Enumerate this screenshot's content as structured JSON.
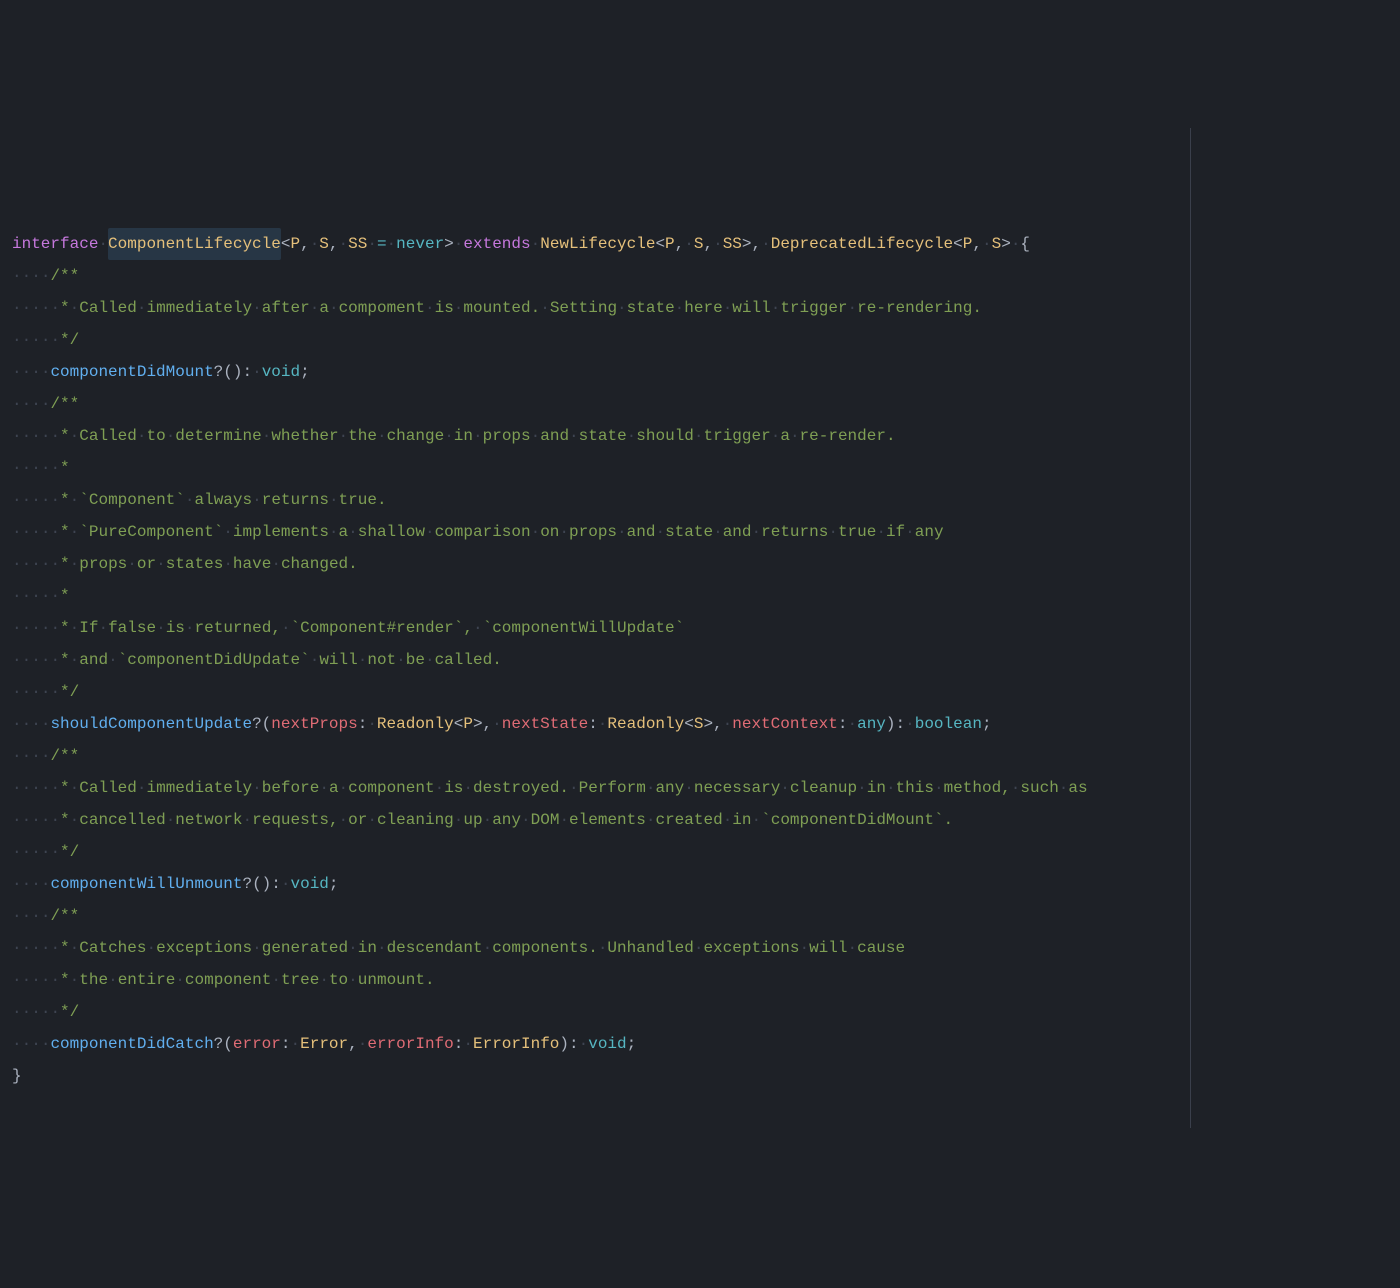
{
  "colors": {
    "background": "#1e2127",
    "keyword": "#c678dd",
    "type": "#e5c07b",
    "comment": "#7f9f54",
    "function": "#61afef",
    "param": "#e06c75",
    "primitive": "#56b6c2",
    "default": "#abb2bf",
    "whitespace_dot": "#3e4451"
  },
  "code": {
    "lines": [
      {
        "indent": 0,
        "segments": [
          {
            "class": "kw",
            "text": "interface"
          },
          {
            "class": "pale",
            "text": " "
          },
          {
            "class": "type highlight-word",
            "text": "ComponentLifecycle"
          },
          {
            "class": "punct",
            "text": "<"
          },
          {
            "class": "typename",
            "text": "P"
          },
          {
            "class": "punct",
            "text": ", "
          },
          {
            "class": "typename",
            "text": "S"
          },
          {
            "class": "punct",
            "text": ", "
          },
          {
            "class": "typename",
            "text": "SS"
          },
          {
            "class": "pale",
            "text": " "
          },
          {
            "class": "op",
            "text": "="
          },
          {
            "class": "pale",
            "text": " "
          },
          {
            "class": "primitive",
            "text": "never"
          },
          {
            "class": "punct",
            "text": "> "
          },
          {
            "class": "kw",
            "text": "extends"
          },
          {
            "class": "pale",
            "text": " "
          },
          {
            "class": "typename",
            "text": "NewLifecycle"
          },
          {
            "class": "punct",
            "text": "<"
          },
          {
            "class": "typename",
            "text": "P"
          },
          {
            "class": "punct",
            "text": ", "
          },
          {
            "class": "typename",
            "text": "S"
          },
          {
            "class": "punct",
            "text": ", "
          },
          {
            "class": "typename",
            "text": "SS"
          },
          {
            "class": "punct",
            "text": ">, "
          },
          {
            "class": "typename",
            "text": "DeprecatedLifecycle"
          },
          {
            "class": "punct",
            "text": "<"
          },
          {
            "class": "typename",
            "text": "P"
          },
          {
            "class": "punct",
            "text": ", "
          },
          {
            "class": "typename",
            "text": "S"
          },
          {
            "class": "punct",
            "text": "> {"
          }
        ]
      },
      {
        "indent": 2,
        "segments": [
          {
            "class": "comment",
            "text": "/**"
          }
        ]
      },
      {
        "indent": 2,
        "segments": [
          {
            "class": "guide",
            "text": "│"
          },
          {
            "class": "comment",
            "text": "* Called immediately after a compoment is mounted. Setting state here will trigger re-rendering."
          }
        ]
      },
      {
        "indent": 2,
        "segments": [
          {
            "class": "guide",
            "text": "│"
          },
          {
            "class": "comment",
            "text": "*/"
          }
        ]
      },
      {
        "indent": 2,
        "segments": [
          {
            "class": "fn",
            "text": "componentDidMount"
          },
          {
            "class": "punct",
            "text": "?(): "
          },
          {
            "class": "primitive",
            "text": "void"
          },
          {
            "class": "punct",
            "text": ";"
          }
        ]
      },
      {
        "indent": 2,
        "segments": [
          {
            "class": "comment",
            "text": "/**"
          }
        ]
      },
      {
        "indent": 2,
        "segments": [
          {
            "class": "guide",
            "text": "│"
          },
          {
            "class": "comment",
            "text": "* Called to determine whether the change in props and state should trigger a re-render."
          }
        ]
      },
      {
        "indent": 2,
        "segments": [
          {
            "class": "guide",
            "text": "│"
          },
          {
            "class": "comment",
            "text": "*"
          }
        ]
      },
      {
        "indent": 2,
        "segments": [
          {
            "class": "guide",
            "text": "│"
          },
          {
            "class": "comment",
            "text": "* `Component` always returns true."
          }
        ]
      },
      {
        "indent": 2,
        "segments": [
          {
            "class": "guide",
            "text": "│"
          },
          {
            "class": "comment",
            "text": "* `PureComponent` implements a shallow comparison on props and state and returns true if any"
          }
        ]
      },
      {
        "indent": 2,
        "segments": [
          {
            "class": "guide",
            "text": "│"
          },
          {
            "class": "comment",
            "text": "* props or states have changed."
          }
        ]
      },
      {
        "indent": 2,
        "segments": [
          {
            "class": "guide",
            "text": "│"
          },
          {
            "class": "comment",
            "text": "*"
          }
        ]
      },
      {
        "indent": 2,
        "segments": [
          {
            "class": "guide",
            "text": "│"
          },
          {
            "class": "comment",
            "text": "* If false is returned, `Component#render`, `componentWillUpdate`"
          }
        ]
      },
      {
        "indent": 2,
        "segments": [
          {
            "class": "guide",
            "text": "│"
          },
          {
            "class": "comment",
            "text": "* and `componentDidUpdate` will not be called."
          }
        ]
      },
      {
        "indent": 2,
        "segments": [
          {
            "class": "guide",
            "text": "│"
          },
          {
            "class": "comment",
            "text": "*/"
          }
        ]
      },
      {
        "indent": 2,
        "segments": [
          {
            "class": "fn",
            "text": "shouldComponentUpdate"
          },
          {
            "class": "punct",
            "text": "?("
          },
          {
            "class": "param",
            "text": "nextProps"
          },
          {
            "class": "punct",
            "text": ": "
          },
          {
            "class": "typename",
            "text": "Readonly"
          },
          {
            "class": "punct",
            "text": "<"
          },
          {
            "class": "typename",
            "text": "P"
          },
          {
            "class": "punct",
            "text": ">, "
          },
          {
            "class": "param",
            "text": "nextState"
          },
          {
            "class": "punct",
            "text": ": "
          },
          {
            "class": "typename",
            "text": "Readonly"
          },
          {
            "class": "punct",
            "text": "<"
          },
          {
            "class": "typename",
            "text": "S"
          },
          {
            "class": "punct",
            "text": ">, "
          },
          {
            "class": "param",
            "text": "nextContext"
          },
          {
            "class": "punct",
            "text": ": "
          },
          {
            "class": "primitive",
            "text": "any"
          },
          {
            "class": "punct",
            "text": "): "
          },
          {
            "class": "primitive",
            "text": "boolean"
          },
          {
            "class": "punct",
            "text": ";"
          }
        ]
      },
      {
        "indent": 2,
        "segments": [
          {
            "class": "comment",
            "text": "/**"
          }
        ]
      },
      {
        "indent": 2,
        "segments": [
          {
            "class": "guide",
            "text": "│"
          },
          {
            "class": "comment",
            "text": "* Called immediately before a component is destroyed. Perform any necessary cleanup in this method, such as"
          }
        ]
      },
      {
        "indent": 2,
        "segments": [
          {
            "class": "guide",
            "text": "│"
          },
          {
            "class": "comment",
            "text": "* cancelled network requests, or cleaning up any DOM elements created in `componentDidMount`."
          }
        ]
      },
      {
        "indent": 2,
        "segments": [
          {
            "class": "guide",
            "text": "│"
          },
          {
            "class": "comment",
            "text": "*/"
          }
        ]
      },
      {
        "indent": 2,
        "segments": [
          {
            "class": "fn",
            "text": "componentWillUnmount"
          },
          {
            "class": "punct",
            "text": "?(): "
          },
          {
            "class": "primitive",
            "text": "void"
          },
          {
            "class": "punct",
            "text": ";"
          }
        ]
      },
      {
        "indent": 2,
        "segments": [
          {
            "class": "comment",
            "text": "/**"
          }
        ]
      },
      {
        "indent": 2,
        "segments": [
          {
            "class": "guide",
            "text": "│"
          },
          {
            "class": "comment",
            "text": "* Catches exceptions generated in descendant components. Unhandled exceptions will cause"
          }
        ]
      },
      {
        "indent": 2,
        "segments": [
          {
            "class": "guide",
            "text": "│"
          },
          {
            "class": "comment",
            "text": "* the entire component tree to unmount."
          }
        ]
      },
      {
        "indent": 2,
        "segments": [
          {
            "class": "guide",
            "text": "│"
          },
          {
            "class": "comment",
            "text": "*/"
          }
        ]
      },
      {
        "indent": 2,
        "segments": [
          {
            "class": "fn",
            "text": "componentDidCatch"
          },
          {
            "class": "punct",
            "text": "?("
          },
          {
            "class": "param",
            "text": "error"
          },
          {
            "class": "punct",
            "text": ": "
          },
          {
            "class": "typename",
            "text": "Error"
          },
          {
            "class": "punct",
            "text": ", "
          },
          {
            "class": "param",
            "text": "errorInfo"
          },
          {
            "class": "punct",
            "text": ": "
          },
          {
            "class": "typename",
            "text": "ErrorInfo"
          },
          {
            "class": "punct",
            "text": "): "
          },
          {
            "class": "primitive",
            "text": "void"
          },
          {
            "class": "punct",
            "text": ";"
          }
        ]
      },
      {
        "indent": 0,
        "segments": [
          {
            "class": "punct",
            "text": "}"
          }
        ]
      }
    ]
  }
}
